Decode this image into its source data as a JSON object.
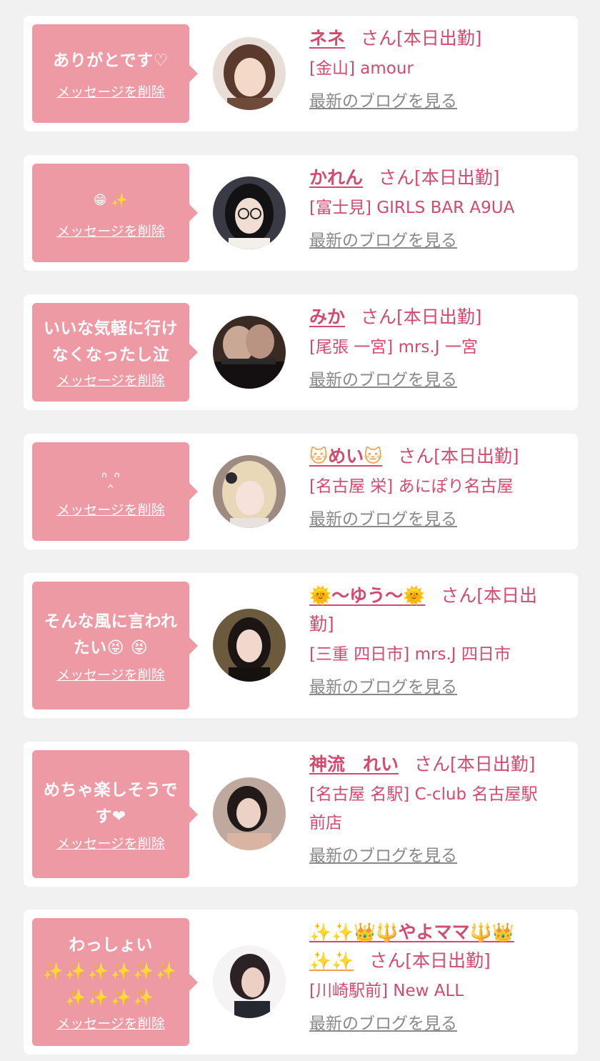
{
  "cards": [
    {
      "message_lines": [
        "ありがとです♡"
      ],
      "delete_label": "メッセージを削除",
      "name": "ネネ",
      "suffix": "さん[本日出勤]",
      "shop": "[金山] amour",
      "blog_label": "最新のブログを見る"
    },
    {
      "message_lines": [
        "😁 ✨"
      ],
      "delete_label": "メッセージを削除",
      "name": "かれん",
      "suffix": "さん[本日出勤]",
      "shop": "[富士見] GIRLS BAR A9UA",
      "blog_label": "最新のブログを見る"
    },
    {
      "message_lines": [
        "いいな気軽に行け",
        "なくなったし泣"
      ],
      "delete_label": "メッセージを削除",
      "name": "みか",
      "suffix": "さん[本日出勤]",
      "shop": "[尾張 一宮] mrs.J 一宮",
      "blog_label": "最新のブログを見る"
    },
    {
      "message_lines": [
        "ᐢ‸ᐢ"
      ],
      "delete_label": "メッセージを削除",
      "name": "めい",
      "name_emoji": "🐱",
      "suffix": "さん[本日出勤]",
      "shop": "[名古屋 栄] あにぽり名古屋",
      "blog_label": "最新のブログを見る"
    },
    {
      "message_lines": [
        "そんな風に言われ",
        "たい😝 😝"
      ],
      "delete_label": "メッセージを削除",
      "name": "〜ゆう〜",
      "name_emoji": "🌞",
      "suffix": "さん[本日出",
      "suffix_line2": "勤]",
      "shop": "[三重 四日市] mrs.J 四日市",
      "blog_label": "最新のブログを見る"
    },
    {
      "message_lines": [
        "めちゃ楽しそうで",
        "す❤"
      ],
      "delete_label": "メッセージを削除",
      "name": "神流　れい",
      "suffix": "さん[本日出勤]",
      "shop": "[名古屋 名駅] C-club 名古屋駅",
      "shop_line2": "前店",
      "blog_label": "最新のブログを見る"
    },
    {
      "message_lines": [
        "わっしょい",
        "✨✨✨✨✨✨",
        "✨✨✨✨"
      ],
      "delete_label": "メッセージを削除",
      "name": "やよママ",
      "name_prefix": "✨✨👑🔱",
      "name_postfix": "🔱👑",
      "name_line2": "✨✨",
      "suffix": "さん[本日出勤]",
      "shop": "[川崎駅前] New ALL",
      "blog_label": "最新のブログを見る"
    }
  ],
  "colors": {
    "background": "#f1f1f1",
    "card": "#ffffff",
    "bubble": "#ee9aa4",
    "name_text": "#d44a6e",
    "blog_link": "#888888"
  }
}
